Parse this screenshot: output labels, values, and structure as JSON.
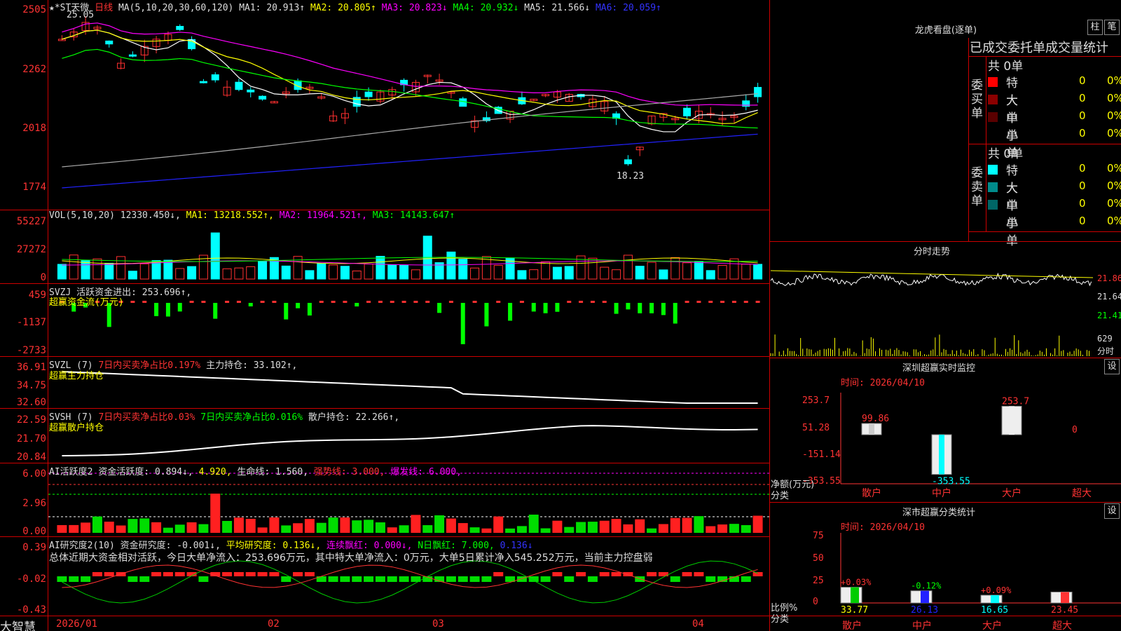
{
  "app": {
    "brand": "大智慧"
  },
  "stock": {
    "name": "★*ST天微",
    "period": "日线",
    "high_label": "25.05",
    "low_label": "18.23"
  },
  "ma": {
    "title": "MA(5,10,20,30,60,120)",
    "ma1": "MA1: 20.913↑",
    "ma2": "MA2: 20.805↑",
    "ma3": "MA3: 20.823↓",
    "ma4": "MA4: 20.932↓",
    "ma5": "MA5: 21.566↓",
    "ma6": "MA6: 20.059↑"
  },
  "price_axis": [
    "2505",
    "2262",
    "2018",
    "1774"
  ],
  "vol": {
    "title": "VOL(5,10,20)",
    "value": "12330.450↓,",
    "ma1": "MA1: 13218.552↑,",
    "ma2": "MA2: 11964.521↑,",
    "ma3": "MA3: 14143.647↑",
    "axis": [
      "55227",
      "27272",
      "0"
    ]
  },
  "svzj": {
    "title": "SVZJ",
    "label": "活跃资金进出: 253.696↑,",
    "sub": "超赢资金流(万元)",
    "axis": [
      "459",
      "-1137",
      "-2733"
    ]
  },
  "svzl": {
    "title": "SVZL (7)",
    "ratio": "7日内买卖净占比0.197%",
    "label": "主力持仓: 33.102↑,",
    "sub": "超赢主力持仓",
    "axis": [
      "36.91",
      "34.75",
      "32.60"
    ]
  },
  "svsh": {
    "title": "SVSH (7)",
    "ratio1": "7日内买卖净占比0.03%",
    "ratio2": "7日内买卖净占比0.016%",
    "label": "散户持仓: 22.266↑,",
    "sub": "超赢散户持仓",
    "axis": [
      "22.59",
      "21.70",
      "20.84"
    ]
  },
  "ai1": {
    "title": "AI活跃度2",
    "l1": "资金活跃度: 0.894↓,",
    "l2": "4.920,",
    "l3": "生命线: 1.560,",
    "l4": "强势线: 3.000,",
    "l5": "爆发线: 6.000,",
    "axis": [
      "6.00",
      "2.96",
      "0.00"
    ]
  },
  "ai2": {
    "title": "AI研究度2(10)",
    "l1": "资金研究度: -0.001↓,",
    "l2": "平均研究度: 0.136↓,",
    "l3": "连续飘红: 0.000↓,",
    "l4": "N日飘红: 7.000,",
    "l5": "0.136↓",
    "summary": "总体近期大资金相对活跃，今日大单净流入：253.696万元，其中特大单净流入：0万元，大单5日累计净入545.252万元，当前主力控盘弱",
    "axis": [
      "0.39",
      "-0.02",
      "-0.43"
    ]
  },
  "dates": [
    "2026/01",
    "02",
    "03",
    "04"
  ],
  "lhb": {
    "title": "龙虎看盘(逐单)",
    "btn1": "柱",
    "btn2": "笔",
    "header": "已成交委托单成交量统计",
    "buy": {
      "total": "共 0单",
      "side": "委买单",
      "rows": [
        {
          "label": "特大",
          "v1": "0",
          "v2": "0%",
          "color": "#ff0000"
        },
        {
          "label": "大单",
          "v1": "0",
          "v2": "0%",
          "color": "#8b0000"
        },
        {
          "label": "中单",
          "v1": "0",
          "v2": "0%",
          "color": "#5a0000"
        },
        {
          "label": "小单",
          "v1": "0",
          "v2": "0%",
          "color": "#000000"
        }
      ]
    },
    "sell": {
      "total": "共 0单",
      "side": "委卖单",
      "rows": [
        {
          "label": "特大",
          "v1": "0",
          "v2": "0%",
          "color": "#00ffff"
        },
        {
          "label": "大单",
          "v1": "0",
          "v2": "0%",
          "color": "#008b8b"
        },
        {
          "label": "中单",
          "v1": "0",
          "v2": "0%",
          "color": "#006666"
        },
        {
          "label": "小单",
          "v1": "0",
          "v2": "0%",
          "color": "#000000"
        }
      ]
    }
  },
  "intraday": {
    "title": "分时走势",
    "axis": [
      "21.86",
      "21.64",
      "21.41"
    ],
    "vol_axis": [
      "629",
      "分时"
    ]
  },
  "sz_monitor": {
    "title": "深圳超赢实时监控",
    "settings": "设",
    "time": "时间: 2026/04/10",
    "axis": [
      "253.7",
      "51.28",
      "-151.14",
      "-353.55"
    ],
    "unit": "净额(万元)",
    "cat_label": "分类",
    "chart_data": {
      "type": "bar",
      "categories": [
        "散户",
        "中户",
        "大户",
        "超大"
      ],
      "values": [
        99.86,
        -353.55,
        253.7,
        0
      ],
      "value_labels": [
        "99.86",
        "-353.55",
        "253.7",
        "0"
      ],
      "ylim": [
        -353.55,
        253.7
      ]
    }
  },
  "sz_class": {
    "title": "深市超赢分类统计",
    "settings": "设",
    "time": "时间: 2026/04/10",
    "axis": [
      "75",
      "50",
      "25",
      "0"
    ],
    "unit": "比例%",
    "cat_label": "分类",
    "chart_data": {
      "type": "bar",
      "categories": [
        "散户",
        "中户",
        "大户",
        "超大"
      ],
      "values": [
        33.77,
        26.13,
        16.65,
        23.45
      ],
      "value_labels": [
        "33.77",
        "26.13",
        "16.65",
        "23.45"
      ],
      "changes": [
        "+0.03%",
        "-0.12%",
        "+0.09%",
        ""
      ],
      "ylim": [
        0,
        75
      ]
    }
  }
}
